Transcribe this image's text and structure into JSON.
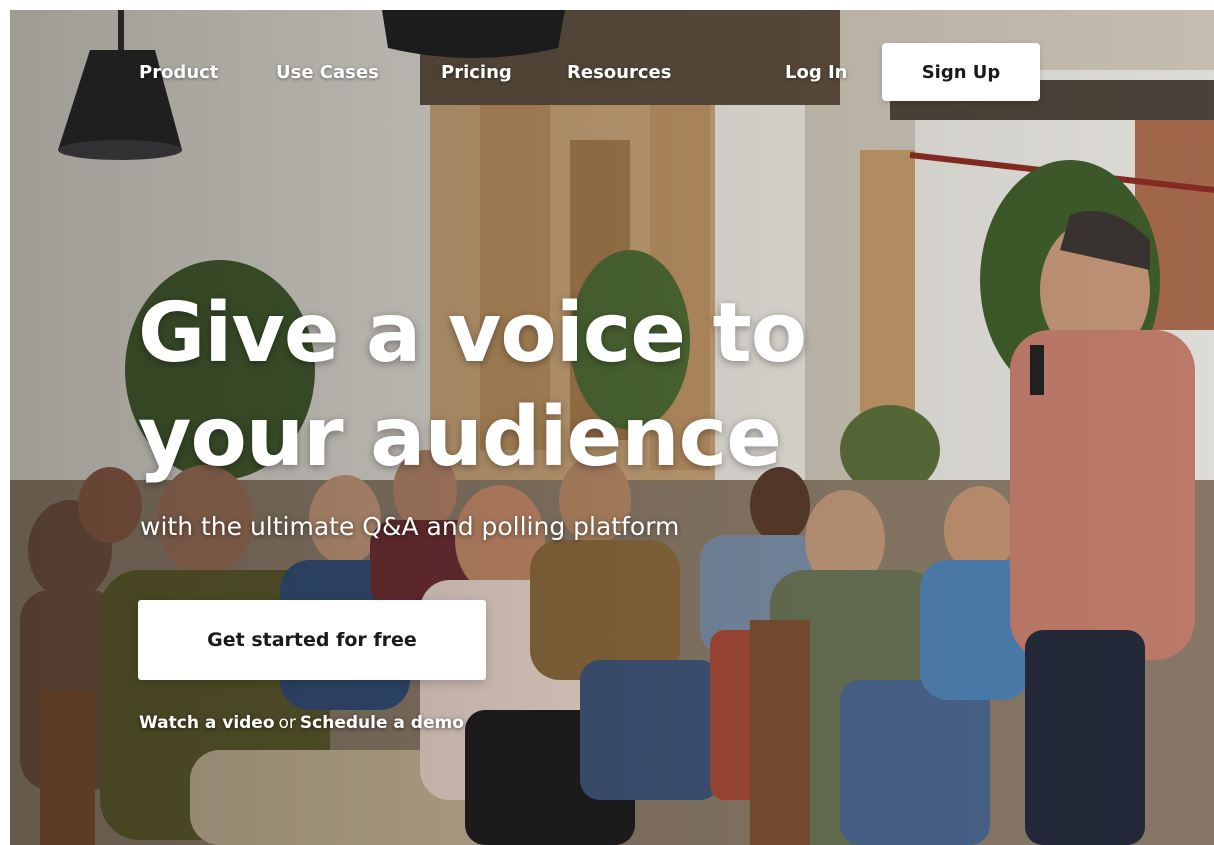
{
  "nav": {
    "items": [
      {
        "label": "Product"
      },
      {
        "label": "Use Cases"
      },
      {
        "label": "Pricing"
      },
      {
        "label": "Resources"
      }
    ],
    "login_label": "Log In",
    "signup_label": "Sign Up"
  },
  "hero": {
    "headline": "Give a voice to your audience",
    "subheadline": "with the ultimate Q&A and polling platform",
    "cta_label": "Get started for free",
    "watch_video_label": "Watch a video",
    "or_text": "or",
    "schedule_demo_label": "Schedule a demo"
  },
  "colors": {
    "button_bg": "#ffffff",
    "button_text": "#1a1a1a",
    "hero_text": "#ffffff"
  },
  "icons": [
    "pendant-lamp-icon"
  ]
}
